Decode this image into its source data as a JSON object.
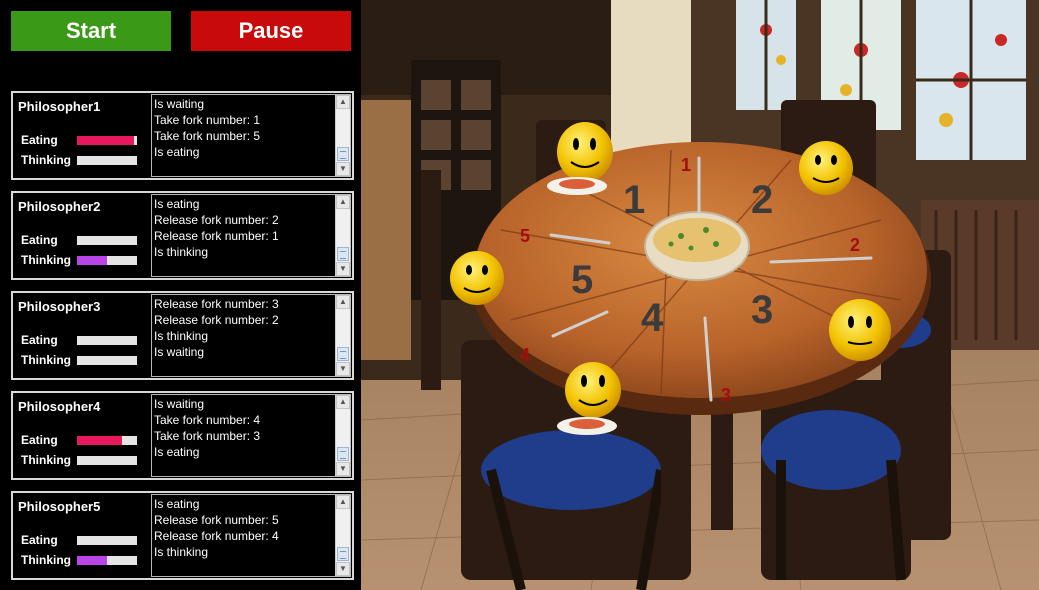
{
  "controls": {
    "start_label": "Start",
    "pause_label": "Pause"
  },
  "labels": {
    "eating": "Eating",
    "thinking": "Thinking"
  },
  "philosophers": [
    {
      "name": "Philosopher1",
      "eating": 0.95,
      "thinking": 0.0,
      "log": [
        "Is waiting",
        "Take fork number: 1",
        "Take fork number: 5",
        "Is eating"
      ]
    },
    {
      "name": "Philosopher2",
      "eating": 0.0,
      "thinking": 0.5,
      "log": [
        "Is eating",
        "Release fork number: 2",
        "Release fork number: 1",
        "Is thinking"
      ]
    },
    {
      "name": "Philosopher3",
      "eating": 0.0,
      "thinking": 0.0,
      "log": [
        "Release fork number: 3",
        "Release fork number: 2",
        "Is thinking",
        "Is waiting"
      ]
    },
    {
      "name": "Philosopher4",
      "eating": 0.75,
      "thinking": 0.0,
      "log": [
        "Is waiting",
        "Take fork number: 4",
        "Take fork number: 3",
        "Is eating"
      ]
    },
    {
      "name": "Philosopher5",
      "eating": 0.0,
      "thinking": 0.5,
      "log": [
        "Is eating",
        "Release fork number: 5",
        "Release fork number: 4",
        "Is thinking"
      ]
    }
  ],
  "table": {
    "seat_numbers": [
      "1",
      "2",
      "3",
      "4",
      "5"
    ],
    "fork_numbers": [
      "1",
      "2",
      "3",
      "4",
      "5"
    ]
  },
  "colors": {
    "start": "#3a9a18",
    "pause": "#c90a0a",
    "eating_bar": "#e8185f",
    "thinking_bar": "#b944e8"
  }
}
